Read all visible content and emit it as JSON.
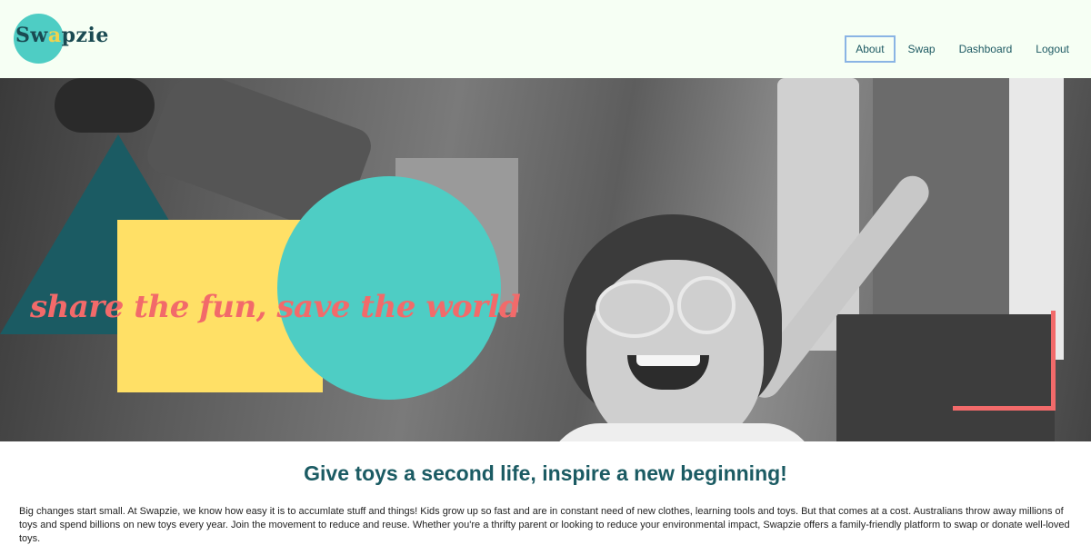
{
  "brand": {
    "logo_text_a": "Sw",
    "logo_text_y": "a",
    "logo_text_b": "pzie"
  },
  "nav": {
    "items": [
      {
        "label": "About",
        "active": true
      },
      {
        "label": "Swap",
        "active": false
      },
      {
        "label": "Dashboard",
        "active": false
      },
      {
        "label": "Logout",
        "active": false
      }
    ]
  },
  "hero": {
    "tagline": "share the fun, save the world",
    "colors": {
      "teal": "#4ecdc4",
      "dark_teal": "#1b5b63",
      "yellow": "#ffe066",
      "coral": "#f26a6a"
    }
  },
  "content": {
    "headline": "Give toys a second life, inspire a new beginning!",
    "paragraph": "Big changes start small. At Swapzie, we know how easy it is to accumlate stuff and things! Kids grow up so fast and are in constant need of new clothes, learning tools and toys. But that comes at a cost. Australians throw away millions of toys and spend billions on new toys every year. Join the movement to reduce and reuse. Whether you're a thrifty parent or looking to reduce your environmental impact, Swapzie offers a family-friendly platform to swap or donate well-loved toys."
  }
}
